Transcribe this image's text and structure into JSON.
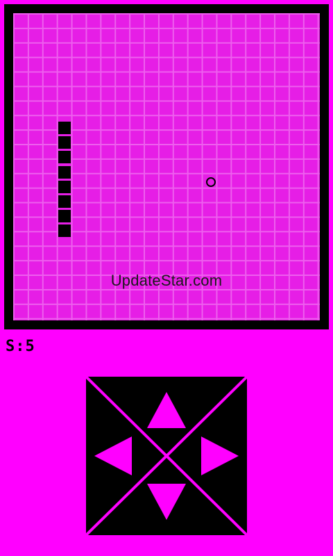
{
  "game": {
    "score_label": "S:5",
    "watermark": "UpdateStar.com",
    "grid": {
      "cols": 21,
      "rows": 21
    },
    "snake": [
      {
        "col": 3,
        "row": 8
      },
      {
        "col": 3,
        "row": 9
      },
      {
        "col": 3,
        "row": 10
      },
      {
        "col": 3,
        "row": 11
      },
      {
        "col": 3,
        "row": 12
      },
      {
        "col": 3,
        "row": 13
      },
      {
        "col": 3,
        "row": 14
      },
      {
        "col": 3,
        "row": 15
      }
    ],
    "food": {
      "col": 13,
      "row": 11
    }
  },
  "colors": {
    "background": "#ff00ff",
    "board": "#e61ee6",
    "grid_lines": "#ee5fee",
    "snake": "#000000",
    "controls": "#000000",
    "arrows": "#ff00ff"
  },
  "controls": {
    "up": "up-arrow-icon",
    "down": "down-arrow-icon",
    "left": "left-arrow-icon",
    "right": "right-arrow-icon"
  }
}
